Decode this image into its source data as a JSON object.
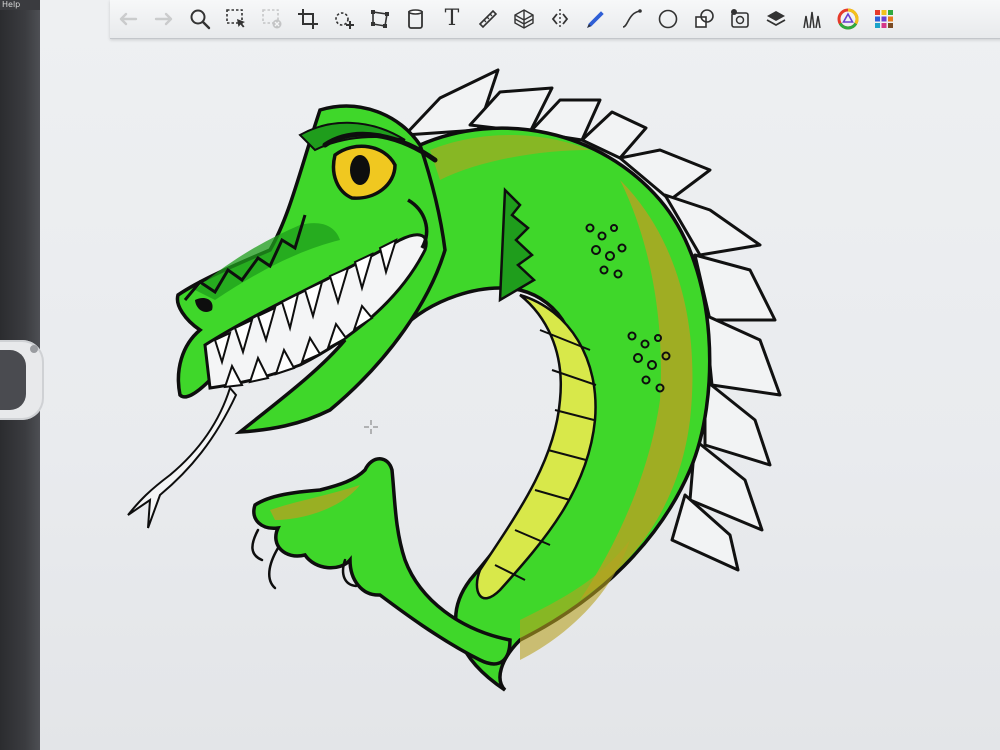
{
  "menubar": {
    "help_label": "Help"
  },
  "toolbar": {
    "tools": [
      {
        "name": "undo-icon",
        "enabled": false
      },
      {
        "name": "redo-icon",
        "enabled": false
      },
      {
        "name": "zoom-icon",
        "enabled": true
      },
      {
        "name": "selection-icon",
        "enabled": true
      },
      {
        "name": "clear-selection-icon",
        "enabled": false
      },
      {
        "name": "crop-icon",
        "enabled": true
      },
      {
        "name": "transform-icon",
        "enabled": true
      },
      {
        "name": "distort-icon",
        "enabled": true
      },
      {
        "name": "fill-bucket-icon",
        "enabled": true
      },
      {
        "name": "text-icon",
        "enabled": true
      },
      {
        "name": "ruler-icon",
        "enabled": true
      },
      {
        "name": "perspective-grid-icon",
        "enabled": true
      },
      {
        "name": "symmetry-icon",
        "enabled": true
      },
      {
        "name": "pen-tool-icon",
        "enabled": true
      },
      {
        "name": "curve-icon",
        "enabled": true
      },
      {
        "name": "ellipse-icon",
        "enabled": true
      },
      {
        "name": "shapes-icon",
        "enabled": true
      },
      {
        "name": "image-icon",
        "enabled": true
      },
      {
        "name": "layers-icon",
        "enabled": true
      },
      {
        "name": "brushes-icon",
        "enabled": true
      },
      {
        "name": "color-wheel-icon",
        "enabled": true
      },
      {
        "name": "swatches-icon",
        "enabled": true
      }
    ],
    "text_tool_label": "T"
  },
  "colors": {
    "dragon_green": "#3fd72a",
    "dragon_dark_green": "#1f9d1c",
    "ochre_shading": "#b8a222",
    "belly_yellow": "#d8e84a",
    "eye_yellow": "#f0c820",
    "ink": "#0e0e0e",
    "canvas": "#eceef0"
  }
}
